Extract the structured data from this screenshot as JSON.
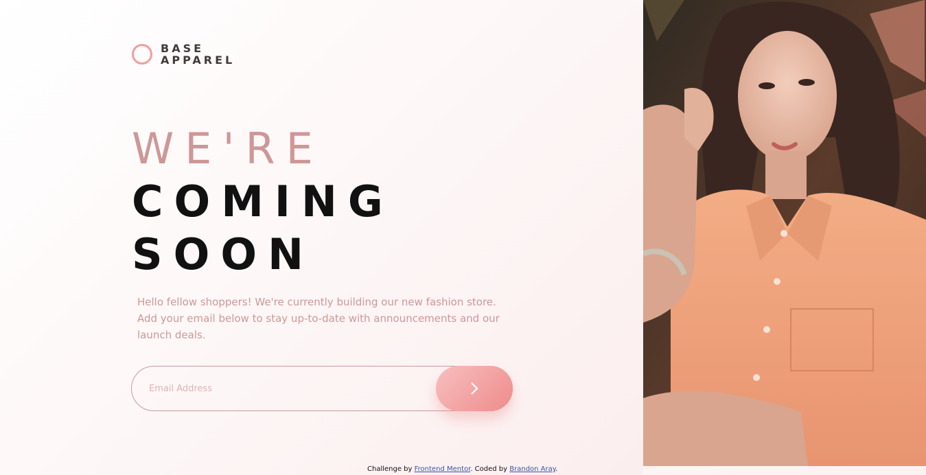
{
  "brand": {
    "line1": "BASE",
    "line2": "APPAREL"
  },
  "headline": {
    "light": "WE'RE",
    "dark1": "COMING",
    "dark2": "SOON"
  },
  "description": "Hello fellow shoppers! We're currently building our new fashion store. Add your email below to stay up-to-date with announcements and our launch deals.",
  "form": {
    "email_placeholder": "Email Address",
    "submit_icon": "chevron-right-icon"
  },
  "footer": {
    "prefix": "Challenge by",
    "link1": "Frontend Mentor",
    "middle": ". Coded by",
    "link2": "Brandon Aray",
    "suffix": "."
  },
  "hero": {
    "icon": "hero-photo"
  },
  "colors": {
    "accent": "#ce9797",
    "button_from": "#f8bfbf",
    "button_to": "#ee8b8b",
    "dark_text": "#423a3a",
    "shirt": "#f0a67e"
  }
}
